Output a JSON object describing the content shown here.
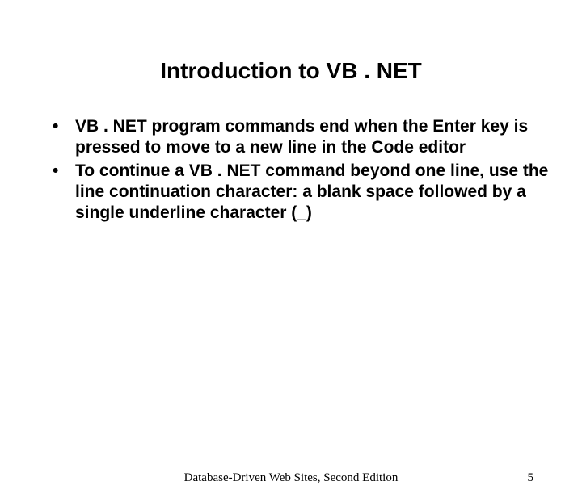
{
  "title": "Introduction to VB . NET",
  "bullets": [
    "VB . NET program commands end when the Enter key is pressed to move to a new line in the Code editor",
    "To continue a VB . NET command beyond one line, use the line continuation character: a blank space followed by a single underline character (_)"
  ],
  "footer": {
    "text": "Database-Driven Web Sites, Second Edition",
    "page": "5"
  }
}
